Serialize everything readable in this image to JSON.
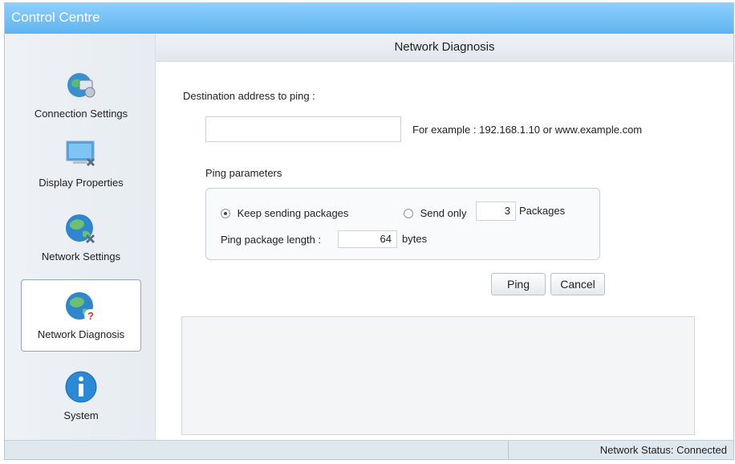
{
  "app": {
    "title": "Control Centre"
  },
  "sidebar": {
    "items": [
      {
        "label": "Connection Settings",
        "icon": "connection-settings-icon"
      },
      {
        "label": "Display Properties",
        "icon": "display-properties-icon"
      },
      {
        "label": "Network Settings",
        "icon": "network-settings-icon"
      },
      {
        "label": "Network Diagnosis",
        "icon": "network-diagnosis-icon"
      },
      {
        "label": "System",
        "icon": "system-info-icon"
      }
    ],
    "active": "Network Diagnosis"
  },
  "main": {
    "header": "Network Diagnosis",
    "destination_label": "Destination address to ping :",
    "destination_value": "",
    "example_text": "For example : 192.168.1.10 or www.example.com",
    "ping_params_label": "Ping parameters",
    "keep_sending_label": "Keep sending packages",
    "send_only_label": "Send only",
    "packages_count": "3",
    "packages_label": "Packages",
    "package_length_label": "Ping package length :",
    "package_length_value": "64",
    "bytes_label": "bytes",
    "ping_button": "Ping",
    "cancel_button": "Cancel",
    "selected_mode": "keep_sending"
  },
  "status": {
    "text": "Network Status: Connected"
  },
  "colors": {
    "titlebar": "#5fb3ee",
    "accent": "#2f86cc",
    "status_bar": "#dfe7ef"
  }
}
